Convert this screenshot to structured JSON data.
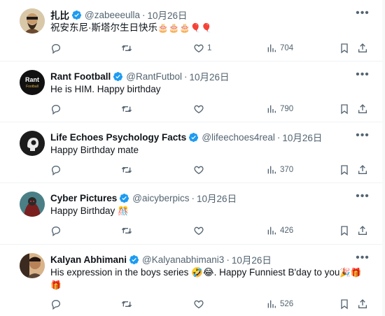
{
  "tweets": [
    {
      "name": "扎比",
      "handle": "@zabeeeulla",
      "dot": "·",
      "date": "10月26日",
      "text": "祝安东尼·斯塔尔生日快乐",
      "emoji": "🎂🎂🎂🎈🎈",
      "replies": "",
      "retweets": "",
      "likes": "1",
      "views": "704"
    },
    {
      "name": "Rant Football",
      "handle": "@RantFutbol",
      "dot": "·",
      "date": "10月26日",
      "text": "He is HIM. Happy birthday",
      "emoji": "",
      "replies": "",
      "retweets": "",
      "likes": "",
      "views": "790"
    },
    {
      "name": "Life Echoes Psychology Facts",
      "handle": "@lifeechoes4real",
      "dot": "·",
      "date": "10月26日",
      "text": "Happy Birthday mate",
      "emoji": "",
      "replies": "",
      "retweets": "",
      "likes": "",
      "views": "370"
    },
    {
      "name": "Cyber Pictures",
      "handle": "@aicyberpics",
      "dot": "·",
      "date": "10月26日",
      "text": "Happy Birthday",
      "emoji": "🎊",
      "replies": "",
      "retweets": "",
      "likes": "",
      "views": "426"
    },
    {
      "name": "Kalyan Abhimani",
      "handle": "@Kalyanabhimani3",
      "dot": "·",
      "date": "10月26日",
      "text": "His expression in the boys series 🤣😂. Happy Funniest B'day to you",
      "emoji": "🎉🎁🎁",
      "replies": "",
      "retweets": "",
      "likes": "",
      "views": "526"
    }
  ],
  "icons": {
    "verified": "verified-badge-icon",
    "more": "more-icon",
    "reply": "reply-icon",
    "retweet": "retweet-icon",
    "like": "like-icon",
    "views": "views-icon",
    "bookmark": "bookmark-icon",
    "share": "share-icon"
  },
  "colors": {
    "verified": "#1d9bf0",
    "muted": "#536471",
    "text": "#0f1419",
    "divider": "#eff3f4"
  }
}
